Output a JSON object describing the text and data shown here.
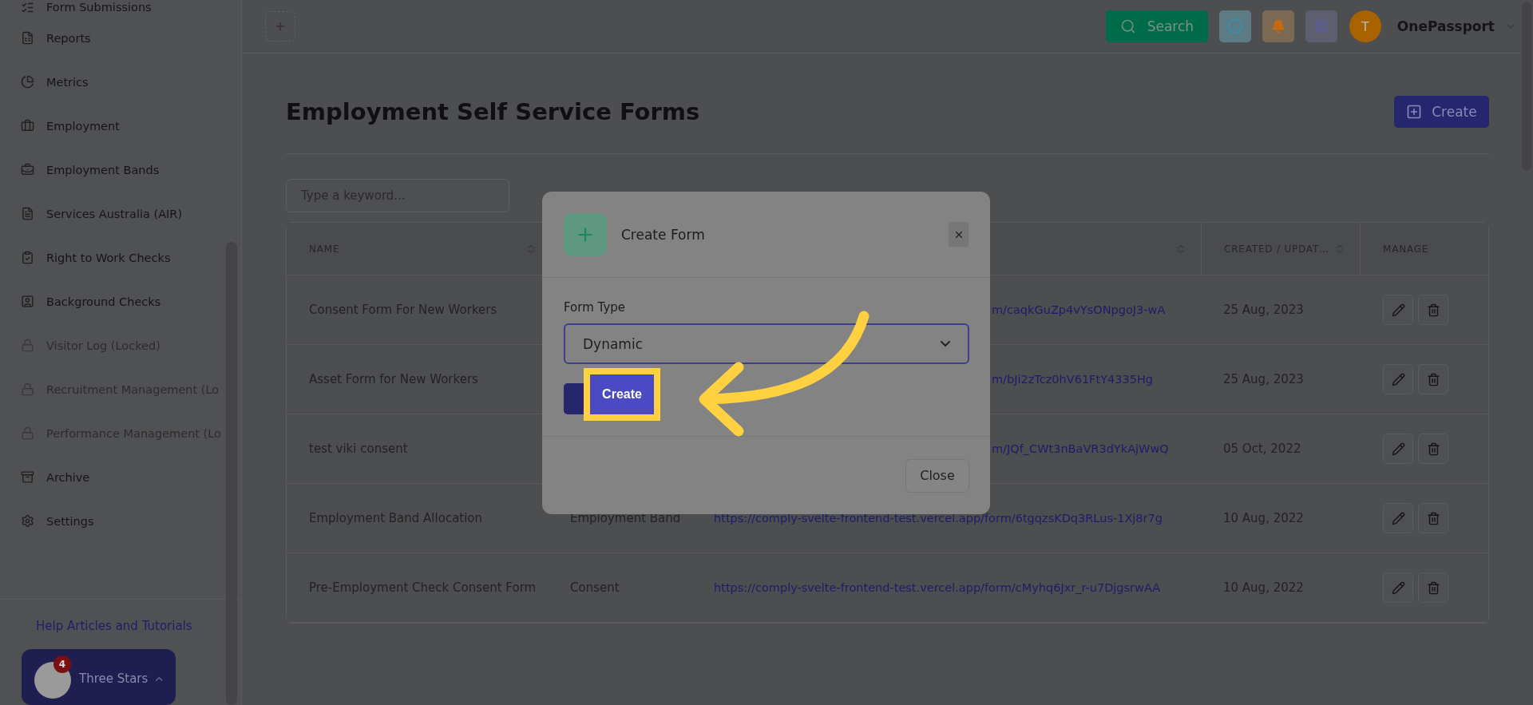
{
  "sidebar": {
    "items": [
      {
        "label": "Form Submissions",
        "locked": false
      },
      {
        "label": "Reports",
        "locked": false
      },
      {
        "label": "Metrics",
        "locked": false
      },
      {
        "label": "Employment",
        "locked": false
      },
      {
        "label": "Employment Bands",
        "locked": false
      },
      {
        "label": "Services Australia (AIR)",
        "locked": false
      },
      {
        "label": "Right to Work Checks",
        "locked": false
      },
      {
        "label": "Background Checks",
        "locked": false
      },
      {
        "label": "Visitor Log (Locked)",
        "locked": true
      },
      {
        "label": "Recruitment Management (Lo",
        "locked": true
      },
      {
        "label": "Performance Management (Lo",
        "locked": true
      },
      {
        "label": "Archive",
        "locked": false
      },
      {
        "label": "Settings",
        "locked": false
      }
    ],
    "help_link": "Help Articles and Tutorials",
    "account_card": {
      "name": "Three Stars",
      "badge": "4"
    }
  },
  "topbar": {
    "search_button": "Search",
    "account": {
      "initial": "T",
      "name": "OnePassport"
    }
  },
  "page": {
    "title": "Employment Self Service Forms",
    "create_button": "Create",
    "search": {
      "placeholder": "Type a keyword..."
    }
  },
  "table": {
    "name_header": "NAME",
    "created_header": "CREATED / UPDAT…",
    "manage_header": "MANAGE",
    "rows": [
      {
        "name": "Consent Form For New Workers",
        "url": "m/caqkGuZp4vYsONpgoJ3-wA",
        "date": "25 Aug, 2023",
        "covered": true
      },
      {
        "name": "Asset Form for New Workers",
        "url": "m/bJi2zTcz0hV61FtY4335Hg",
        "date": "25 Aug, 2023",
        "covered": true
      },
      {
        "name": "test viki consent",
        "url": "m/JQf_CWt3nBaVR3dYkAjWwQ",
        "date": "05 Oct, 2022",
        "covered": true
      },
      {
        "name": "Employment Band Allocation",
        "type": "Employment Band",
        "url": "https://comply-svelte-frontend-test.vercel.app/form/6tgqzsKDq3RLus-1Xj8r7g",
        "date": "10 Aug, 2022",
        "covered": false
      },
      {
        "name": "Pre-Employment Check Consent Form",
        "type": "Consent",
        "url": "https://comply-svelte-frontend-test.vercel.app/form/cMyhq6Jxr_r-u7DjgsrwAA",
        "date": "10 Aug, 2022",
        "covered": false
      }
    ]
  },
  "modal": {
    "title": "Create Form",
    "field_label": "Form Type",
    "value": "Dynamic",
    "create_button": "Create",
    "close_button": "Close"
  }
}
